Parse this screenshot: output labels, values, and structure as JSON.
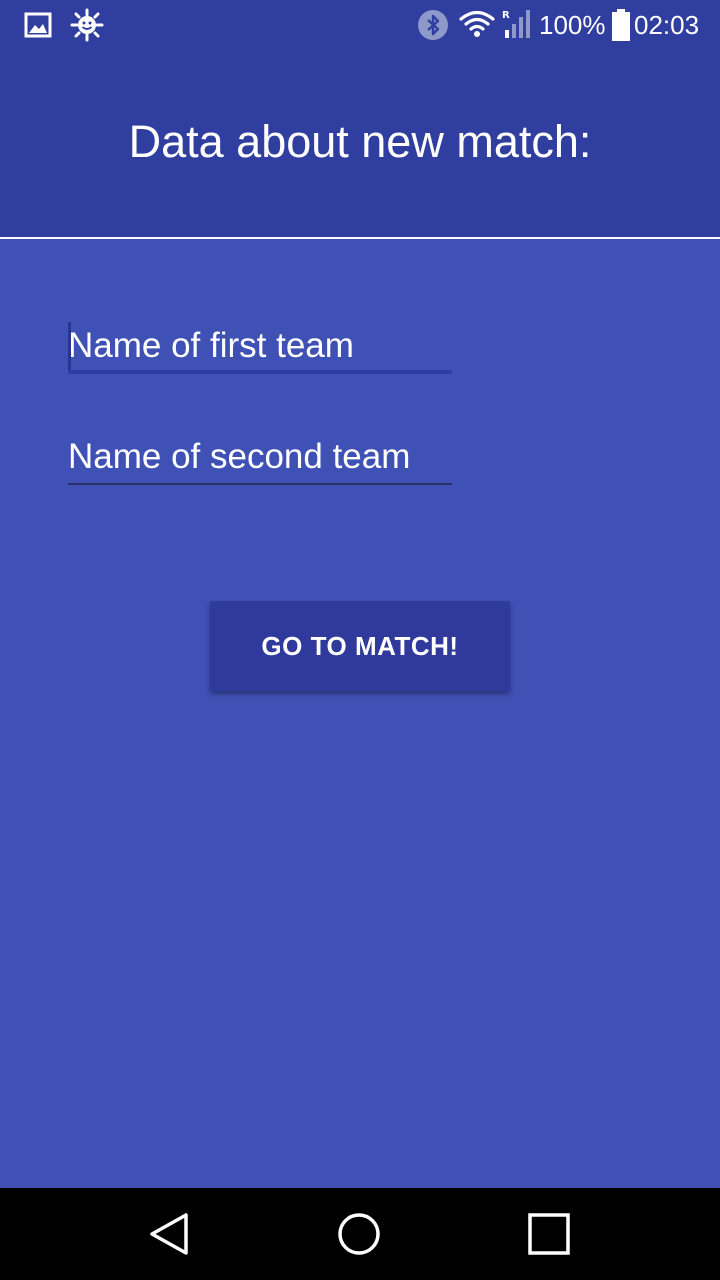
{
  "status_bar": {
    "battery": "100%",
    "time": "02:03",
    "icons": [
      "image-icon",
      "sun-face-icon",
      "bluetooth-icon",
      "wifi-icon",
      "signal-roaming-icon",
      "battery-icon"
    ]
  },
  "toolbar": {
    "title": "Data about new match:"
  },
  "form": {
    "first_team": {
      "value": "",
      "placeholder": "Name of first team"
    },
    "second_team": {
      "value": "",
      "placeholder": "Name of second team"
    },
    "submit_label": "GO TO MATCH!"
  },
  "nav_bar": {
    "icons": [
      "back-icon",
      "home-icon",
      "recents-icon"
    ]
  },
  "colors": {
    "primary": "#3f51b5",
    "primary_dark": "#303f9f",
    "button": "#2f3a9c",
    "text": "#ffffff"
  }
}
